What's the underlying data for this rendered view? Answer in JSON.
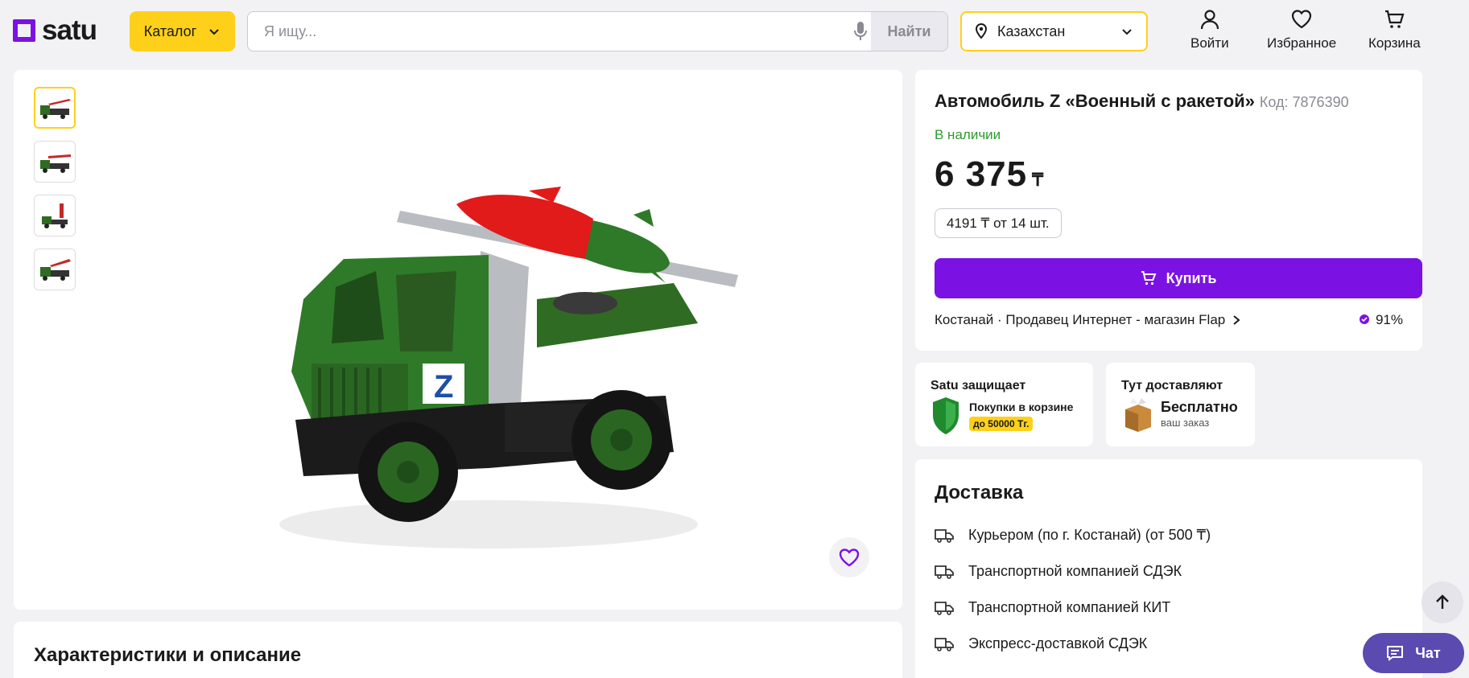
{
  "header": {
    "logo_text": "satu",
    "catalog_label": "Каталог",
    "search_placeholder": "Я ищу...",
    "search_button": "Найти",
    "region": "Казахстан",
    "login_label": "Войти",
    "favorites_label": "Избранное",
    "cart_label": "Корзина"
  },
  "gallery": {
    "thumbnails": [
      "thumbnail-1",
      "thumbnail-2",
      "thumbnail-3",
      "thumbnail-4"
    ],
    "active_index": 0
  },
  "product": {
    "title": "Автомобиль Z «Военный с ракетой»",
    "code": "Код: 7876390",
    "stock": "В наличии",
    "price": "6 375",
    "currency": "₸",
    "wholesale": "4191 ₸ от 14 шт.",
    "buy_label": "Купить",
    "seller": "Костанай · Продавец Интернет - магазин Flap",
    "rating": "91%"
  },
  "protection": {
    "title": "Satu защищает",
    "line1": "Покупки в корзине",
    "line2": "до 50000 Тг."
  },
  "shipping_promo": {
    "title": "Тут доставляют",
    "line1": "Бесплатно",
    "line2": "ваш заказ"
  },
  "delivery": {
    "title": "Доставка",
    "items": [
      "Курьером (по г. Костанай) (от 500 ₸)",
      "Транспортной компанией СДЭК",
      "Транспортной компанией КИТ",
      "Экспресс-доставкой СДЭК"
    ]
  },
  "description": {
    "title": "Характеристики и описание"
  },
  "chat_label": "Чат",
  "colors": {
    "brand_purple": "#7b12e3",
    "accent_yellow": "#ffd01a",
    "stock_green": "#2e9a2e"
  }
}
